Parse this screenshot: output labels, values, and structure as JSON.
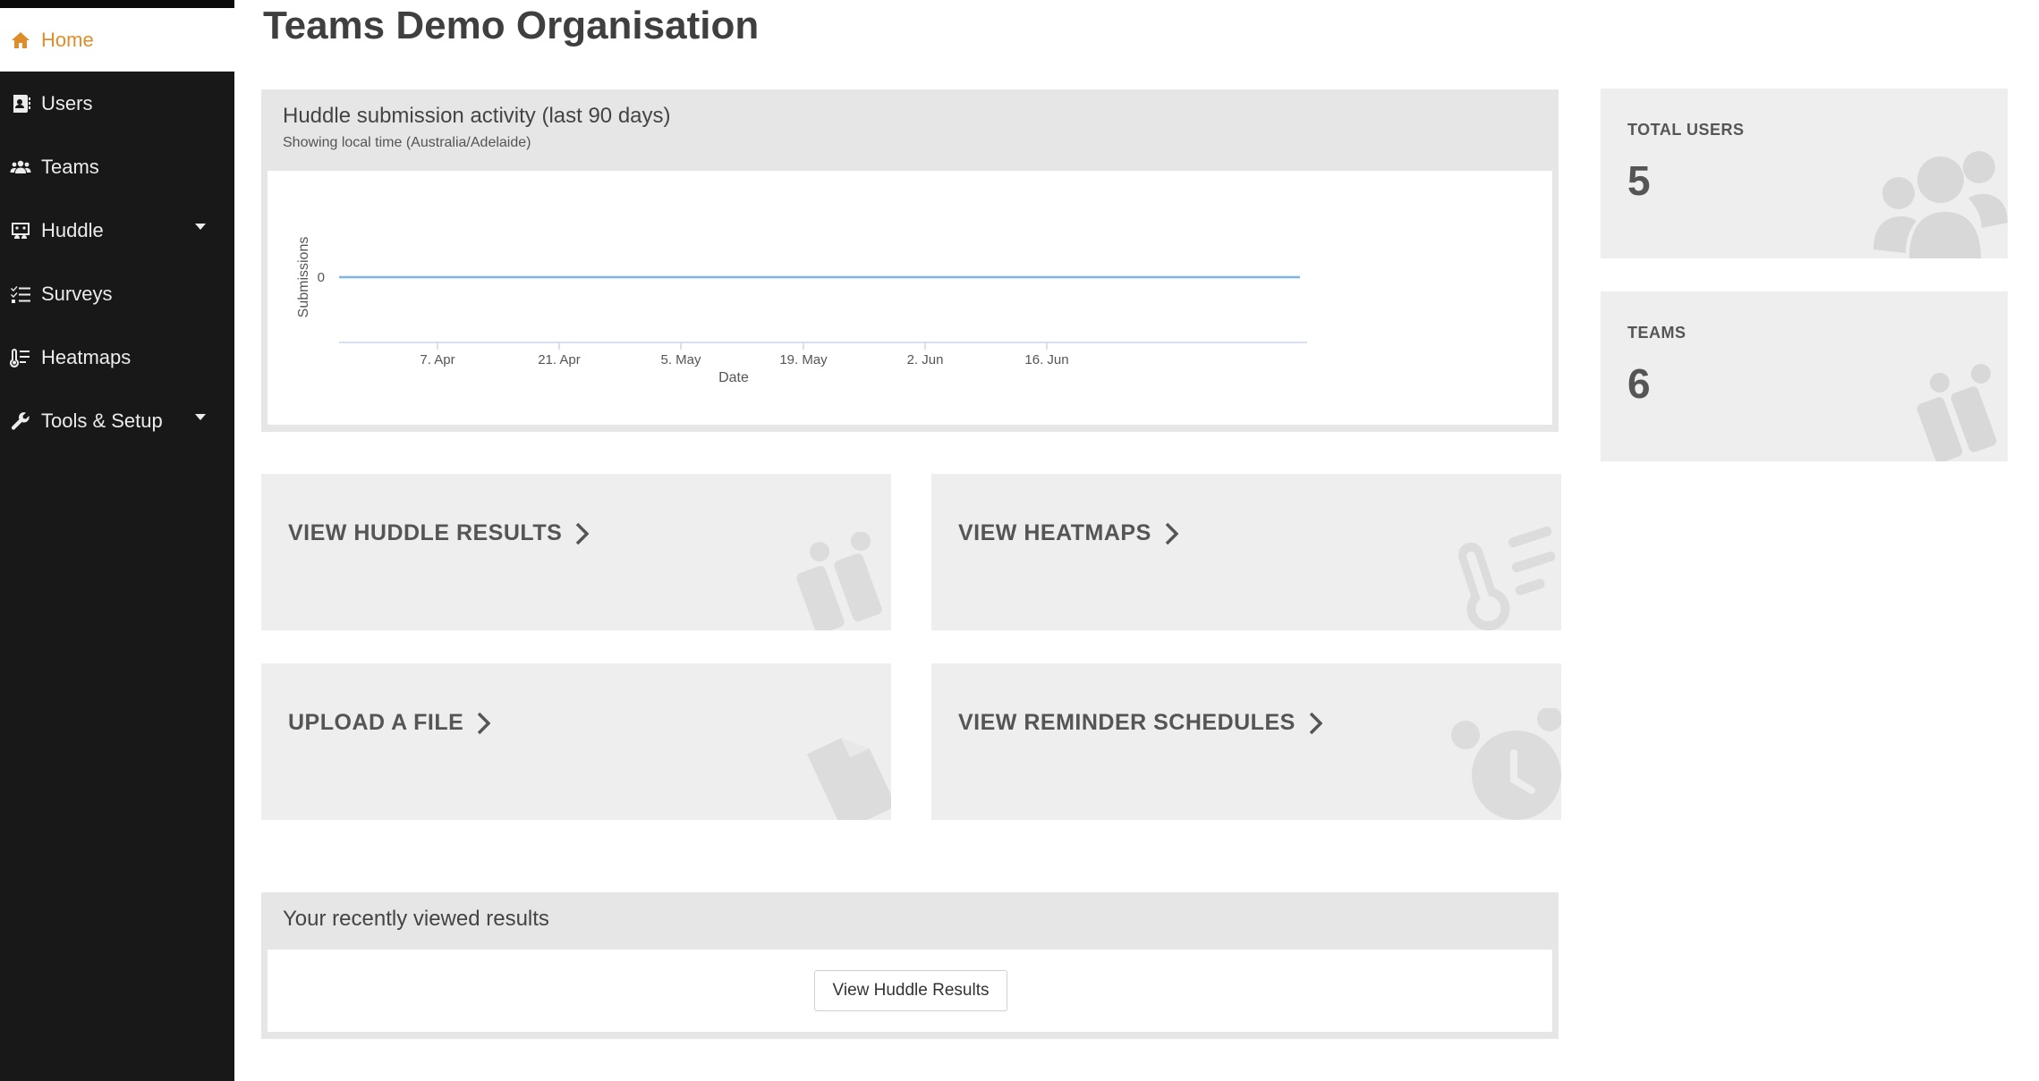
{
  "sidebar": {
    "items": [
      {
        "label": "Home",
        "icon": "home-icon",
        "active": true
      },
      {
        "label": "Users",
        "icon": "address-book-icon"
      },
      {
        "label": "Teams",
        "icon": "users-icon"
      },
      {
        "label": "Huddle",
        "icon": "huddle-board-icon",
        "has_submenu": true
      },
      {
        "label": "Surveys",
        "icon": "checklist-icon"
      },
      {
        "label": "Heatmaps",
        "icon": "thermometer-icon"
      },
      {
        "label": "Tools & Setup",
        "icon": "wrench-icon",
        "has_submenu": true
      }
    ]
  },
  "page": {
    "title": "Teams Demo Organisation"
  },
  "activity": {
    "title": "Huddle submission activity (last 90 days)",
    "subtitle": "Showing local time (Australia/Adelaide)"
  },
  "chart_data": {
    "type": "line",
    "x": [
      "7. Apr",
      "21. Apr",
      "5. May",
      "19. May",
      "2. Jun",
      "16. Jun"
    ],
    "series": [
      {
        "values": [
          0,
          0,
          0,
          0,
          0,
          0
        ]
      }
    ],
    "yticks": [
      "0"
    ],
    "xlabel": "Date",
    "ylabel": "Submissions",
    "line_color": "#7cb5ec",
    "grid": false
  },
  "stats": {
    "total_users": {
      "label": "TOTAL USERS",
      "value": "5"
    },
    "teams": {
      "label": "TEAMS",
      "value": "6"
    }
  },
  "actions": {
    "view_huddle_results": "VIEW HUDDLE RESULTS",
    "view_heatmaps": "VIEW HEATMAPS",
    "upload_file": "UPLOAD A FILE",
    "view_reminder_schedules": "VIEW REMINDER SCHEDULES"
  },
  "recent": {
    "title": "Your recently viewed results",
    "button_label": "View Huddle Results"
  },
  "colors": {
    "sidebar_bg": "#181818",
    "accent": "#e08c2a",
    "card_bg": "#eeeeee"
  }
}
